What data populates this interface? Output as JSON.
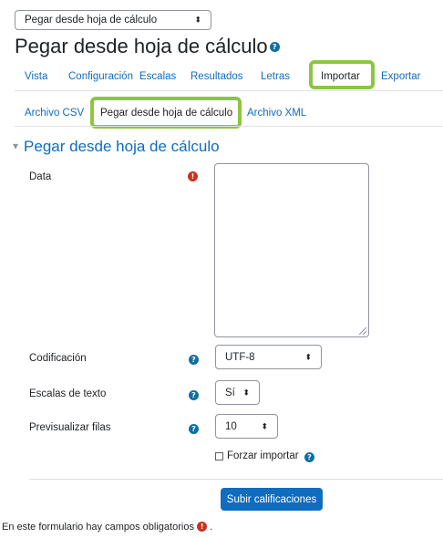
{
  "top_select": {
    "value": "Pegar desde hoja de cálculo"
  },
  "page": {
    "title": "Pegar desde hoja de cálculo"
  },
  "tabs": [
    {
      "label": "Vista"
    },
    {
      "label": "Configuración"
    },
    {
      "label": "Escalas"
    },
    {
      "label": "Resultados"
    },
    {
      "label": "Letras"
    },
    {
      "label": "Importar"
    },
    {
      "label": "Exportar"
    }
  ],
  "subtabs": [
    {
      "label": "Archivo CSV"
    },
    {
      "label": "Pegar desde hoja de cálculo"
    },
    {
      "label": "Archivo XML"
    }
  ],
  "section": {
    "title": "Pegar desde hoja de cálculo",
    "toggle_glyph": "▾"
  },
  "form": {
    "data_label": "Data",
    "encoding_label": "Codificación",
    "encoding_value": "UTF-8",
    "text_scales_label": "Escalas de texto",
    "text_scales_value": "Sí",
    "preview_rows_label": "Previsualizar filas",
    "preview_rows_value": "10",
    "force_import_label": "Forzar importar",
    "submit_label": "Subir calificaciones",
    "required_note": "En este formulario hay campos obligatorios",
    "required_note_suffix": " ."
  },
  "glyphs": {
    "help": "?",
    "required": "!",
    "caret": "⬍"
  },
  "colors": {
    "accent": "#0f6cbf",
    "highlight": "#8cc63f",
    "required": "#ca3120",
    "help": "#0f6fa5"
  }
}
